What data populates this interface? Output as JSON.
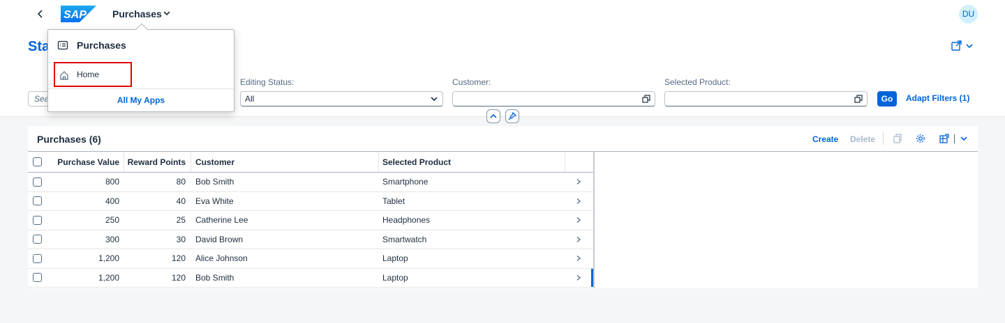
{
  "shell": {
    "logo_text": "SAP",
    "app_title": "Purchases",
    "avatar_initials": "DU",
    "brand_color": "#0070f2"
  },
  "header": {
    "page_title": "Sta",
    "search_placeholder": "Sea"
  },
  "filters": [
    {
      "label": "Editing Status:",
      "value": "All",
      "control": "select"
    },
    {
      "label": "Customer:",
      "value": "",
      "control": "value-help"
    },
    {
      "label": "Selected Product:",
      "value": "",
      "control": "value-help"
    }
  ],
  "filterbar": {
    "go_label": "Go",
    "adapt_label": "Adapt Filters (1)"
  },
  "table": {
    "title": "Purchases (6)",
    "create_label": "Create",
    "delete_label": "Delete",
    "columns": [
      "Purchase Value",
      "Reward Points",
      "Customer",
      "Selected Product"
    ],
    "rows": [
      {
        "purchase_value": "800",
        "reward_points": "80",
        "customer": "Bob Smith",
        "product": "Smartphone"
      },
      {
        "purchase_value": "400",
        "reward_points": "40",
        "customer": "Eva White",
        "product": "Tablet"
      },
      {
        "purchase_value": "250",
        "reward_points": "25",
        "customer": "Catherine Lee",
        "product": "Headphones"
      },
      {
        "purchase_value": "300",
        "reward_points": "30",
        "customer": "David Brown",
        "product": "Smartwatch"
      },
      {
        "purchase_value": "1,200",
        "reward_points": "120",
        "customer": "Alice Johnson",
        "product": "Laptop"
      },
      {
        "purchase_value": "1,200",
        "reward_points": "120",
        "customer": "Bob Smith",
        "product": "Laptop"
      }
    ]
  },
  "popover": {
    "title": "Purchases",
    "home_label": "Home",
    "all_apps_label": "All My Apps",
    "highlight_color": "#e00000"
  },
  "colors": {
    "accent": "#0064d9",
    "text": "#1d2d3e",
    "background": "#f5f6f7"
  }
}
